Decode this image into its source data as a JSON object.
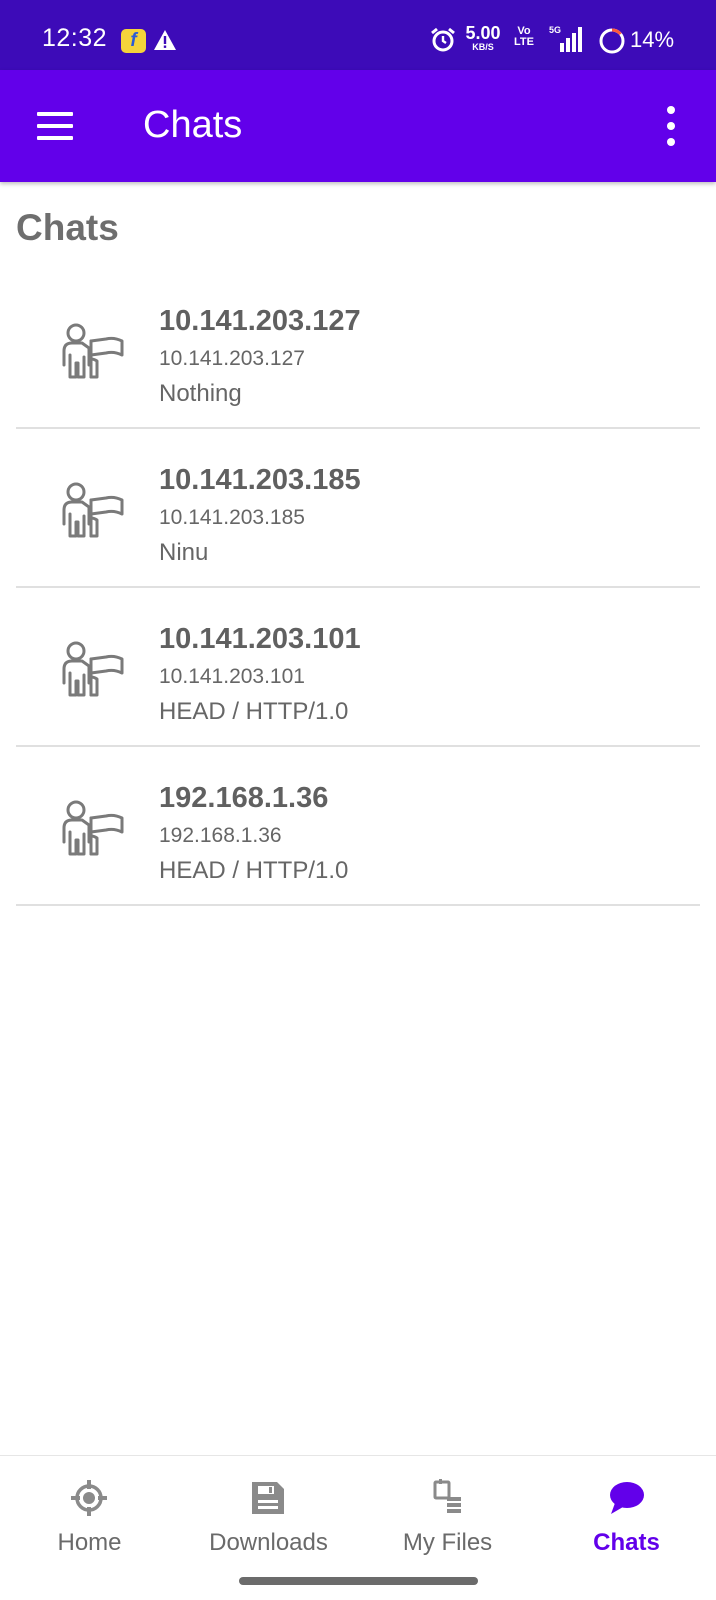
{
  "status_bar": {
    "time": "12:32",
    "network_speed_value": "5.00",
    "network_speed_unit": "KB/S",
    "volte_top": "Vo",
    "volte_bottom": "LTE",
    "signal_label": "5G",
    "battery_percent": "14%",
    "battery_level": 0.14
  },
  "app_bar": {
    "title": "Chats"
  },
  "page": {
    "heading": "Chats"
  },
  "chats": [
    {
      "name": "10.141.203.127",
      "ip": "10.141.203.127",
      "last_message": "Nothing"
    },
    {
      "name": "10.141.203.185",
      "ip": "10.141.203.185",
      "last_message": "Ninu"
    },
    {
      "name": "10.141.203.101",
      "ip": "10.141.203.101",
      "last_message": "HEAD / HTTP/1.0"
    },
    {
      "name": "192.168.1.36",
      "ip": "192.168.1.36",
      "last_message": "HEAD / HTTP/1.0"
    }
  ],
  "bottom_nav": {
    "items": [
      {
        "label": "Home",
        "icon": "crosshair-icon"
      },
      {
        "label": "Downloads",
        "icon": "save-icon"
      },
      {
        "label": "My Files",
        "icon": "files-icon"
      },
      {
        "label": "Chats",
        "icon": "chat-bubble-icon"
      }
    ],
    "active_index": 3
  },
  "colors": {
    "status_bar": "#3d0bb8",
    "app_bar": "#6200ea",
    "accent": "#6200ea",
    "text_secondary": "#6a6a6a"
  }
}
